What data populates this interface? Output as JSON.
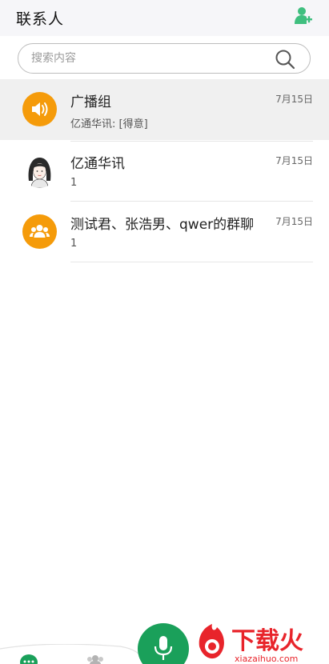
{
  "header": {
    "title": "联系人",
    "add_icon": "add-contact-icon"
  },
  "search": {
    "placeholder": "搜索内容",
    "icon": "search-icon"
  },
  "conversations": [
    {
      "title": "广播组",
      "subtitle": "亿通华讯: [得意]",
      "date": "7月15日",
      "avatar": "speaker-icon",
      "active": true
    },
    {
      "title": "亿通华讯",
      "subtitle": "1",
      "date": "7月15日",
      "avatar": "user-avatar",
      "active": false
    },
    {
      "title": "测试君、张浩男、qwer的群聊",
      "subtitle": "1",
      "date": "7月15日",
      "avatar": "group-icon",
      "active": false
    }
  ],
  "bottom_nav": {
    "items": [
      "chat-icon",
      "contacts-icon"
    ],
    "center": "mic-icon"
  },
  "watermark": {
    "text": "下载火",
    "url_text": "xiazaihuo.com"
  },
  "colors": {
    "accent": "#1aa05a",
    "orange": "#f59b0a",
    "watermark_red": "#e8242b"
  }
}
